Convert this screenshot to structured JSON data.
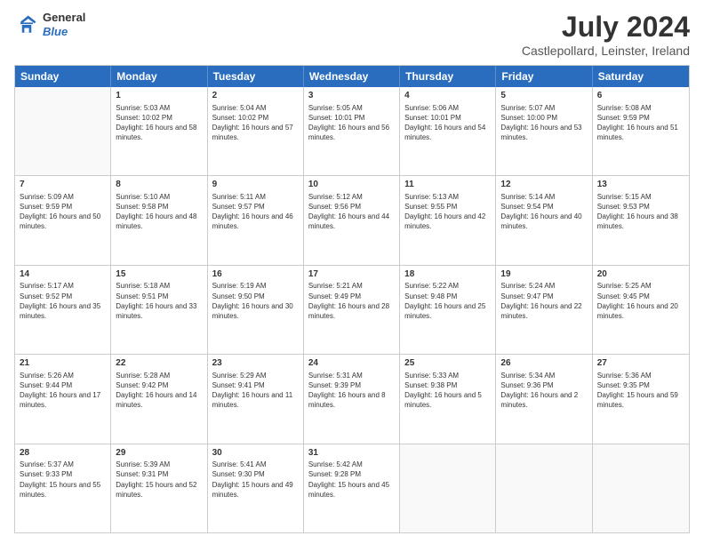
{
  "header": {
    "logo_line1": "General",
    "logo_line2": "Blue",
    "title": "July 2024",
    "subtitle": "Castlepollard, Leinster, Ireland"
  },
  "days_of_week": [
    "Sunday",
    "Monday",
    "Tuesday",
    "Wednesday",
    "Thursday",
    "Friday",
    "Saturday"
  ],
  "weeks": [
    [
      {
        "day": "",
        "sunrise": "",
        "sunset": "",
        "daylight": ""
      },
      {
        "day": "1",
        "sunrise": "Sunrise: 5:03 AM",
        "sunset": "Sunset: 10:02 PM",
        "daylight": "Daylight: 16 hours and 58 minutes."
      },
      {
        "day": "2",
        "sunrise": "Sunrise: 5:04 AM",
        "sunset": "Sunset: 10:02 PM",
        "daylight": "Daylight: 16 hours and 57 minutes."
      },
      {
        "day": "3",
        "sunrise": "Sunrise: 5:05 AM",
        "sunset": "Sunset: 10:01 PM",
        "daylight": "Daylight: 16 hours and 56 minutes."
      },
      {
        "day": "4",
        "sunrise": "Sunrise: 5:06 AM",
        "sunset": "Sunset: 10:01 PM",
        "daylight": "Daylight: 16 hours and 54 minutes."
      },
      {
        "day": "5",
        "sunrise": "Sunrise: 5:07 AM",
        "sunset": "Sunset: 10:00 PM",
        "daylight": "Daylight: 16 hours and 53 minutes."
      },
      {
        "day": "6",
        "sunrise": "Sunrise: 5:08 AM",
        "sunset": "Sunset: 9:59 PM",
        "daylight": "Daylight: 16 hours and 51 minutes."
      }
    ],
    [
      {
        "day": "7",
        "sunrise": "Sunrise: 5:09 AM",
        "sunset": "Sunset: 9:59 PM",
        "daylight": "Daylight: 16 hours and 50 minutes."
      },
      {
        "day": "8",
        "sunrise": "Sunrise: 5:10 AM",
        "sunset": "Sunset: 9:58 PM",
        "daylight": "Daylight: 16 hours and 48 minutes."
      },
      {
        "day": "9",
        "sunrise": "Sunrise: 5:11 AM",
        "sunset": "Sunset: 9:57 PM",
        "daylight": "Daylight: 16 hours and 46 minutes."
      },
      {
        "day": "10",
        "sunrise": "Sunrise: 5:12 AM",
        "sunset": "Sunset: 9:56 PM",
        "daylight": "Daylight: 16 hours and 44 minutes."
      },
      {
        "day": "11",
        "sunrise": "Sunrise: 5:13 AM",
        "sunset": "Sunset: 9:55 PM",
        "daylight": "Daylight: 16 hours and 42 minutes."
      },
      {
        "day": "12",
        "sunrise": "Sunrise: 5:14 AM",
        "sunset": "Sunset: 9:54 PM",
        "daylight": "Daylight: 16 hours and 40 minutes."
      },
      {
        "day": "13",
        "sunrise": "Sunrise: 5:15 AM",
        "sunset": "Sunset: 9:53 PM",
        "daylight": "Daylight: 16 hours and 38 minutes."
      }
    ],
    [
      {
        "day": "14",
        "sunrise": "Sunrise: 5:17 AM",
        "sunset": "Sunset: 9:52 PM",
        "daylight": "Daylight: 16 hours and 35 minutes."
      },
      {
        "day": "15",
        "sunrise": "Sunrise: 5:18 AM",
        "sunset": "Sunset: 9:51 PM",
        "daylight": "Daylight: 16 hours and 33 minutes."
      },
      {
        "day": "16",
        "sunrise": "Sunrise: 5:19 AM",
        "sunset": "Sunset: 9:50 PM",
        "daylight": "Daylight: 16 hours and 30 minutes."
      },
      {
        "day": "17",
        "sunrise": "Sunrise: 5:21 AM",
        "sunset": "Sunset: 9:49 PM",
        "daylight": "Daylight: 16 hours and 28 minutes."
      },
      {
        "day": "18",
        "sunrise": "Sunrise: 5:22 AM",
        "sunset": "Sunset: 9:48 PM",
        "daylight": "Daylight: 16 hours and 25 minutes."
      },
      {
        "day": "19",
        "sunrise": "Sunrise: 5:24 AM",
        "sunset": "Sunset: 9:47 PM",
        "daylight": "Daylight: 16 hours and 22 minutes."
      },
      {
        "day": "20",
        "sunrise": "Sunrise: 5:25 AM",
        "sunset": "Sunset: 9:45 PM",
        "daylight": "Daylight: 16 hours and 20 minutes."
      }
    ],
    [
      {
        "day": "21",
        "sunrise": "Sunrise: 5:26 AM",
        "sunset": "Sunset: 9:44 PM",
        "daylight": "Daylight: 16 hours and 17 minutes."
      },
      {
        "day": "22",
        "sunrise": "Sunrise: 5:28 AM",
        "sunset": "Sunset: 9:42 PM",
        "daylight": "Daylight: 16 hours and 14 minutes."
      },
      {
        "day": "23",
        "sunrise": "Sunrise: 5:29 AM",
        "sunset": "Sunset: 9:41 PM",
        "daylight": "Daylight: 16 hours and 11 minutes."
      },
      {
        "day": "24",
        "sunrise": "Sunrise: 5:31 AM",
        "sunset": "Sunset: 9:39 PM",
        "daylight": "Daylight: 16 hours and 8 minutes."
      },
      {
        "day": "25",
        "sunrise": "Sunrise: 5:33 AM",
        "sunset": "Sunset: 9:38 PM",
        "daylight": "Daylight: 16 hours and 5 minutes."
      },
      {
        "day": "26",
        "sunrise": "Sunrise: 5:34 AM",
        "sunset": "Sunset: 9:36 PM",
        "daylight": "Daylight: 16 hours and 2 minutes."
      },
      {
        "day": "27",
        "sunrise": "Sunrise: 5:36 AM",
        "sunset": "Sunset: 9:35 PM",
        "daylight": "Daylight: 15 hours and 59 minutes."
      }
    ],
    [
      {
        "day": "28",
        "sunrise": "Sunrise: 5:37 AM",
        "sunset": "Sunset: 9:33 PM",
        "daylight": "Daylight: 15 hours and 55 minutes."
      },
      {
        "day": "29",
        "sunrise": "Sunrise: 5:39 AM",
        "sunset": "Sunset: 9:31 PM",
        "daylight": "Daylight: 15 hours and 52 minutes."
      },
      {
        "day": "30",
        "sunrise": "Sunrise: 5:41 AM",
        "sunset": "Sunset: 9:30 PM",
        "daylight": "Daylight: 15 hours and 49 minutes."
      },
      {
        "day": "31",
        "sunrise": "Sunrise: 5:42 AM",
        "sunset": "Sunset: 9:28 PM",
        "daylight": "Daylight: 15 hours and 45 minutes."
      },
      {
        "day": "",
        "sunrise": "",
        "sunset": "",
        "daylight": ""
      },
      {
        "day": "",
        "sunrise": "",
        "sunset": "",
        "daylight": ""
      },
      {
        "day": "",
        "sunrise": "",
        "sunset": "",
        "daylight": ""
      }
    ]
  ]
}
